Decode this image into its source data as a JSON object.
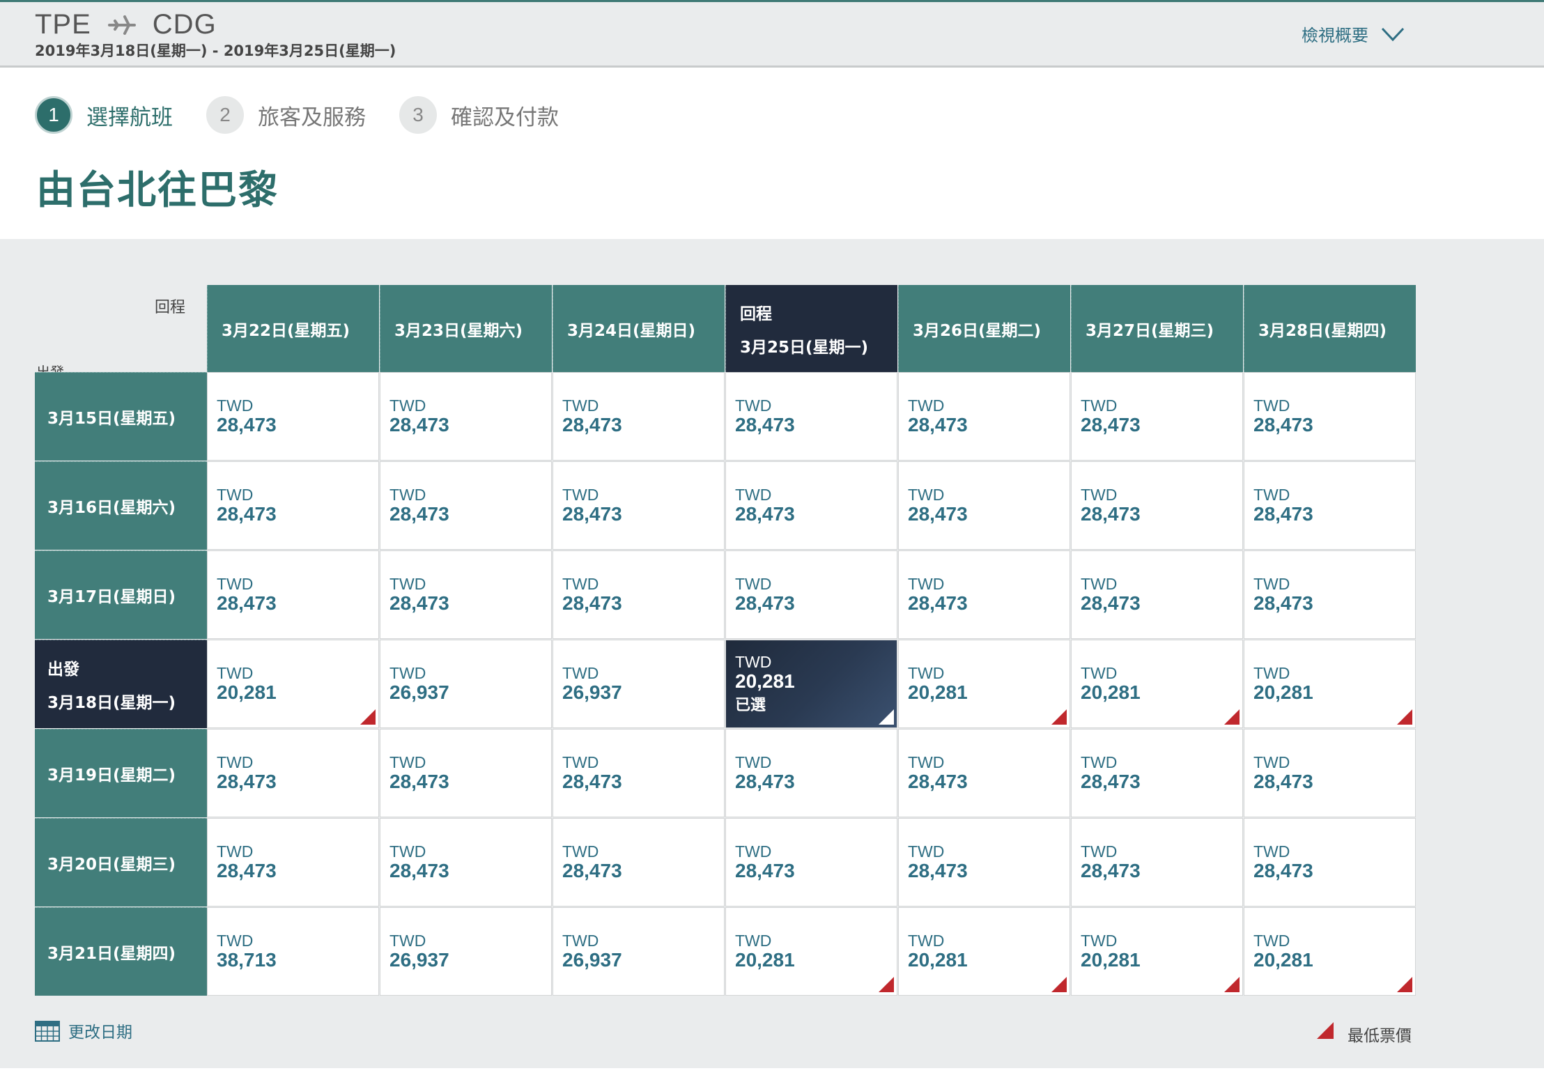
{
  "header": {
    "origin": "TPE",
    "destination": "CDG",
    "date_range": "2019年3月18日(星期一) - 2019年3月25日(星期一)",
    "summary_label": "檢視概要"
  },
  "steps": [
    {
      "num": "1",
      "label": "選擇航班"
    },
    {
      "num": "2",
      "label": "旅客及服務"
    },
    {
      "num": "3",
      "label": "確認及付款"
    }
  ],
  "page_title": "由台北往巴黎",
  "grid": {
    "return_label": "回程",
    "depart_label": "出發",
    "selected_note": "已選",
    "columns": [
      "3月22日(星期五)",
      "3月23日(星期六)",
      "3月24日(星期日)",
      "3月25日(星期一)",
      "3月26日(星期二)",
      "3月27日(星期三)",
      "3月28日(星期四)"
    ],
    "selected_col": 3,
    "selected_row": 3,
    "currency": "TWD",
    "rows": [
      {
        "label": "3月15日(星期五)",
        "prices": [
          "28,473",
          "28,473",
          "28,473",
          "28,473",
          "28,473",
          "28,473",
          "28,473"
        ],
        "lowest": [
          false,
          false,
          false,
          false,
          false,
          false,
          false
        ]
      },
      {
        "label": "3月16日(星期六)",
        "prices": [
          "28,473",
          "28,473",
          "28,473",
          "28,473",
          "28,473",
          "28,473",
          "28,473"
        ],
        "lowest": [
          false,
          false,
          false,
          false,
          false,
          false,
          false
        ]
      },
      {
        "label": "3月17日(星期日)",
        "prices": [
          "28,473",
          "28,473",
          "28,473",
          "28,473",
          "28,473",
          "28,473",
          "28,473"
        ],
        "lowest": [
          false,
          false,
          false,
          false,
          false,
          false,
          false
        ]
      },
      {
        "label": "3月18日(星期一)",
        "prices": [
          "20,281",
          "26,937",
          "26,937",
          "20,281",
          "20,281",
          "20,281",
          "20,281"
        ],
        "lowest": [
          true,
          false,
          false,
          true,
          true,
          true,
          true
        ]
      },
      {
        "label": "3月19日(星期二)",
        "prices": [
          "28,473",
          "28,473",
          "28,473",
          "28,473",
          "28,473",
          "28,473",
          "28,473"
        ],
        "lowest": [
          false,
          false,
          false,
          false,
          false,
          false,
          false
        ]
      },
      {
        "label": "3月20日(星期三)",
        "prices": [
          "28,473",
          "28,473",
          "28,473",
          "28,473",
          "28,473",
          "28,473",
          "28,473"
        ],
        "lowest": [
          false,
          false,
          false,
          false,
          false,
          false,
          false
        ]
      },
      {
        "label": "3月21日(星期四)",
        "prices": [
          "38,713",
          "26,937",
          "26,937",
          "20,281",
          "20,281",
          "20,281",
          "20,281"
        ],
        "lowest": [
          false,
          false,
          false,
          true,
          true,
          true,
          true
        ]
      }
    ]
  },
  "footer": {
    "change_date_label": "更改日期",
    "legend_label": "最低票價"
  },
  "colors": {
    "teal": "#427e7a",
    "navy": "#212b3d",
    "price_text": "#2e6e83",
    "lowest_marker": "#c0282d"
  }
}
